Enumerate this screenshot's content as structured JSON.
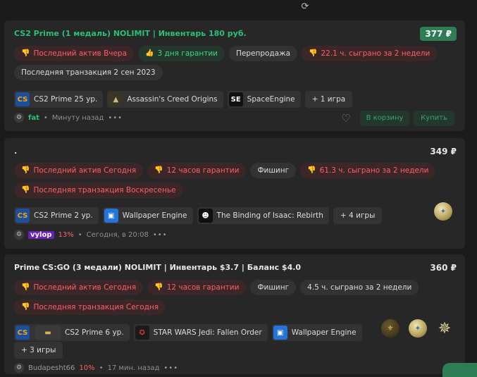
{
  "header": {
    "refresh_icon": "refresh-icon"
  },
  "listings": [
    {
      "title": "CS2 Prime (1 медаль) NOLIMIT | Инвентарь 180 руб.",
      "price": "377 ₽",
      "tags": [
        "Последний актив Вчера",
        "3 дня гарантии",
        "Перепродажа",
        "22.1 ч. сыграно за 2 недели"
      ],
      "tags2": [
        "Последняя транзакция 2 сен 2023"
      ],
      "games": [
        "CS2 Prime 25 ур.",
        "Assassin's Creed Origins",
        "SpaceEngine"
      ],
      "more": "+ 1 игра",
      "seller": "fat",
      "time": "Минуту назад",
      "cart_label": "В корзину",
      "buy_label": "Купить"
    },
    {
      "title": ".",
      "price": "349 ₽",
      "tags": [
        "Последний актив Сегодня",
        "12 часов гарантии",
        "Фишинг",
        "61.3 ч. сыграно за 2 недели"
      ],
      "tags2": [
        "Последняя транзакция Воскресенье"
      ],
      "games": [
        "CS2 Prime 2 ур.",
        "Wallpaper Engine",
        "The Binding of Isaac: Rebirth"
      ],
      "more": "+ 4 игры",
      "seller": "vylop",
      "pct": "13%",
      "time": "Сегодня, в 20:08"
    },
    {
      "title": "Prime CS:GO (3 медали) NOLIMIT | Инвентарь $3.7 | Баланс $4.0",
      "price": "360 ₽",
      "tags": [
        "Последний актив Сегодня",
        "12 часов гарантии",
        "Фишинг",
        "4.5 ч. сыграно за 2 недели"
      ],
      "tags2": [
        "Последняя транзакция Сегодня"
      ],
      "games": [
        "CS2 Prime 6 ур.",
        "STAR WARS Jedi: Fallen Order",
        "Wallpaper Engine"
      ],
      "more": "+ 3 игры",
      "seller": "Budapesht66",
      "pct": "10%",
      "time": "17 мин. назад"
    }
  ],
  "colors": {
    "accent_green": "#2bbf7a",
    "warn_red": "#ff5f66",
    "card_bg": "#272727",
    "page_bg": "#1b1b1b"
  }
}
